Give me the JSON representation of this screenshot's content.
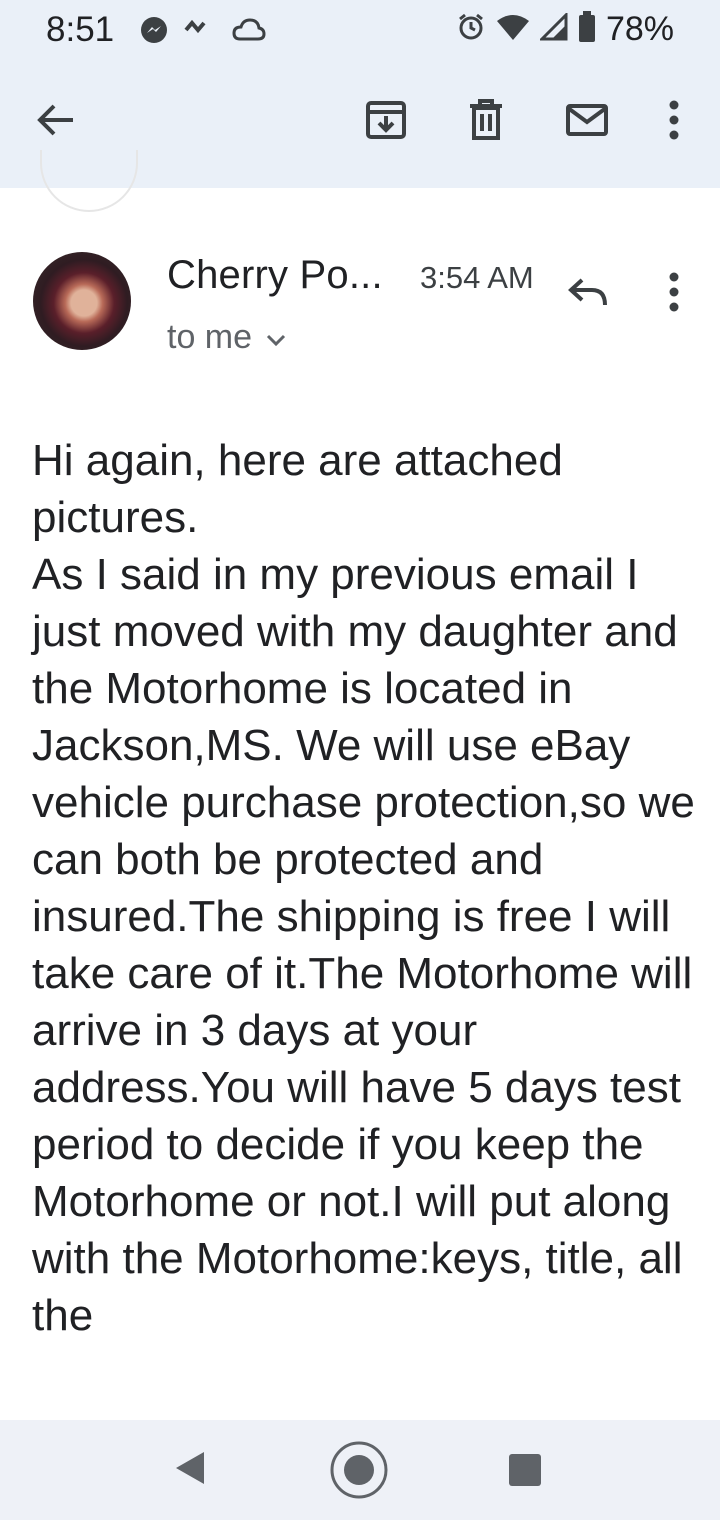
{
  "status_bar": {
    "time": "8:51",
    "battery": "78%",
    "icons": [
      "messenger-icon",
      "cloud-outline-icon",
      "alarm-icon",
      "wifi-icon",
      "signal-icon",
      "battery-icon"
    ]
  },
  "app_bar": {
    "icons": [
      "back-arrow-icon",
      "archive-icon",
      "delete-icon",
      "mark-unread-icon",
      "more-vert-icon"
    ]
  },
  "email": {
    "sender": "Cherry Po...",
    "time": "3:54 AM",
    "recipient": "to me",
    "body": "Hi again, here are attached pictures.\nAs I said in my previous email I just moved with my daughter and the Motorhome is located in Jackson,MS. We will use eBay vehicle purchase protection,so we can both be protected and insured.The shipping is free I will take care of it.The Motorhome will arrive in 3 days at your address.You will have 5 days test period to decide if you keep the Motorhome or not.I will put along with the Motorhome:keys, title, all the"
  },
  "nav_bar": {
    "icons": [
      "back-triangle-icon",
      "home-circle-icon",
      "recents-square-icon"
    ]
  },
  "colors": {
    "header_bg": "#eaf0f8",
    "text": "#202124",
    "secondary": "#5f6368"
  }
}
